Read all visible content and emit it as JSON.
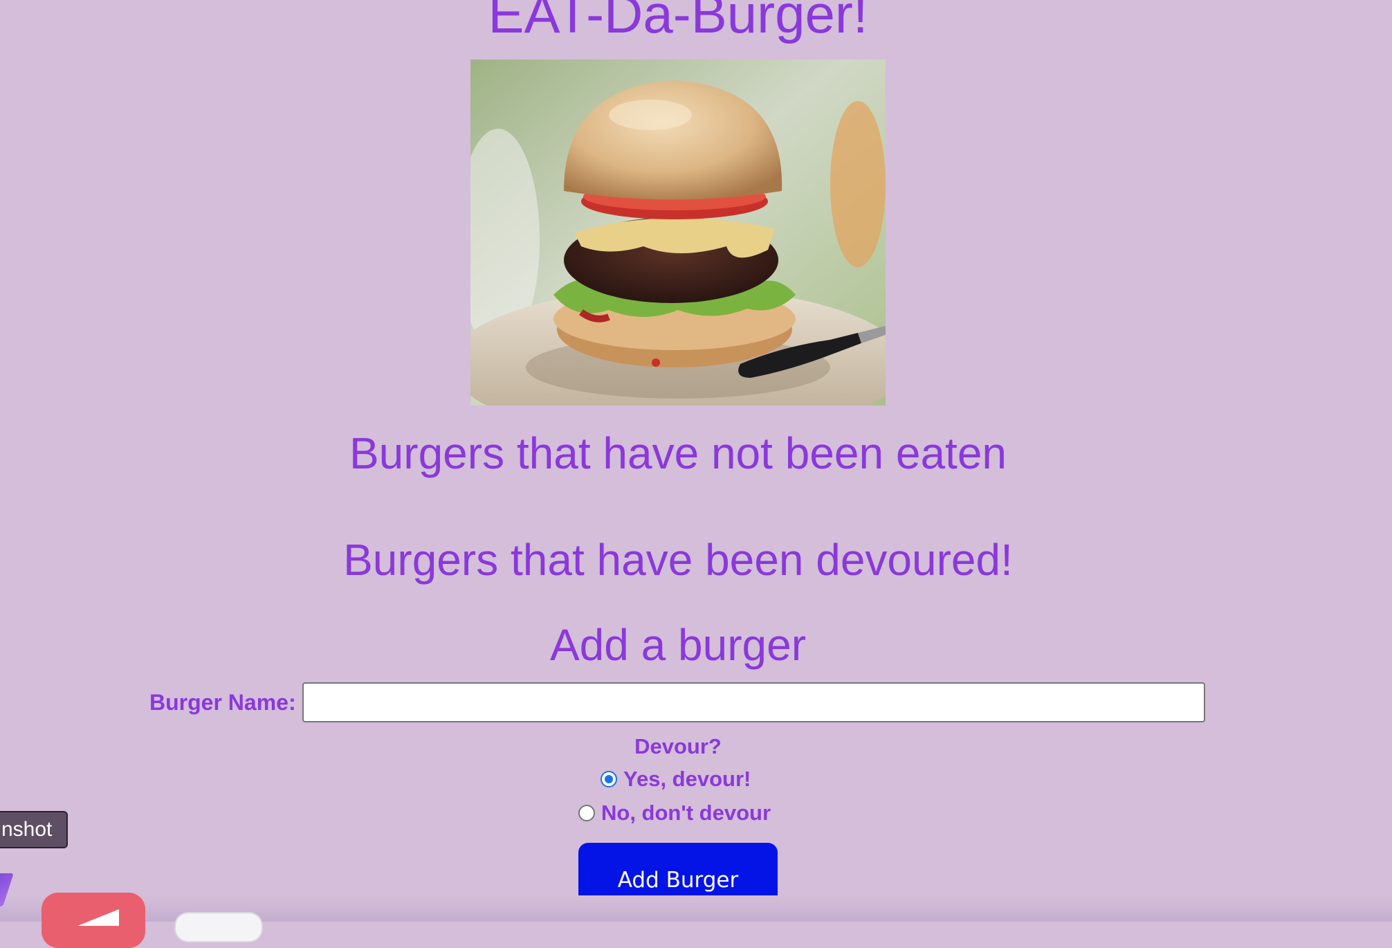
{
  "page": {
    "title": "EAT-Da-Burger!",
    "image_alt": "burger-photo"
  },
  "sections": {
    "not_eaten_heading": "Burgers that have not been eaten",
    "devoured_heading": "Burgers that have been devoured!",
    "add_heading": "Add a burger"
  },
  "form": {
    "name_label": "Burger Name:",
    "name_value": "",
    "devour_label": "Devour?",
    "options": [
      {
        "label": "Yes, devour!",
        "checked": true
      },
      {
        "label": "No, don't devour",
        "checked": false
      }
    ],
    "submit_label": "Add Burger"
  },
  "overlay": {
    "tooltip_text": "nshot"
  },
  "colors": {
    "background": "#d4bed9",
    "text": "#8a38dc",
    "button": "#0514e6",
    "radio_accent": "#1a73e8"
  }
}
